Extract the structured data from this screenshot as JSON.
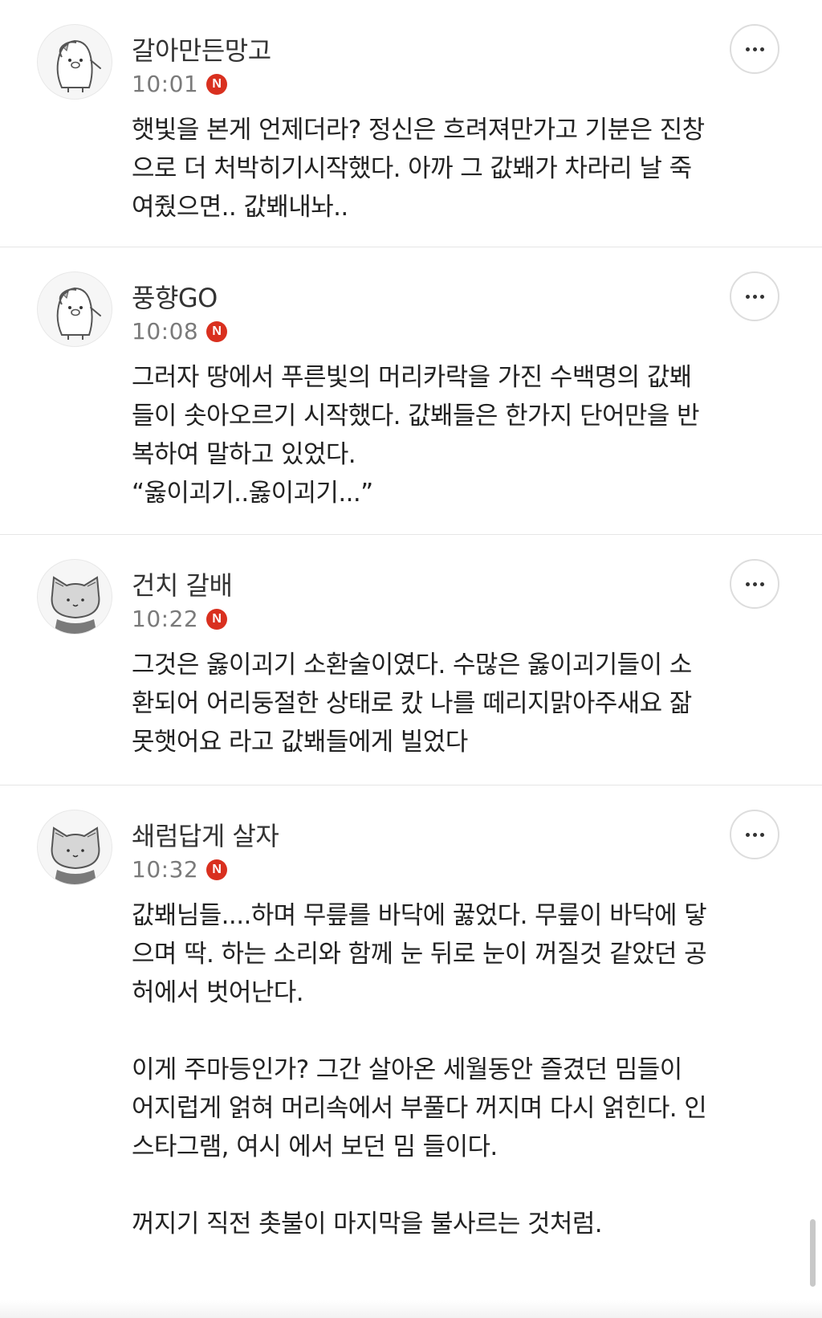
{
  "comments": [
    {
      "nickname": "갈아만든망고",
      "time": "10:01",
      "badge": "N",
      "avatar": "penguin-avatar-icon",
      "paragraphs": [
        "햇빛을 본게 언제더라? 정신은 흐려져만가고 기분은 진창\n으로 더 처박히기시작했다. 아까 그 값봬가 차라리 날 죽\n여줬으면.. 값봬내놔.."
      ]
    },
    {
      "nickname": "풍향GO",
      "time": "10:08",
      "badge": "N",
      "avatar": "penguin-avatar-icon",
      "paragraphs": [
        "그러자 땅에서 푸른빛의 머리카락을 가진 수백명의 값봬\n들이 솟아오르기 시작했다. 값봬들은 한가지 단어만을 반\n복하여 말하고 있었다.\n“옳이괴기..옳이괴기...”"
      ]
    },
    {
      "nickname": "건치 갈배",
      "time": "10:22",
      "badge": "N",
      "avatar": "cat-avatar-icon",
      "paragraphs": [
        "그것은 옳이괴기 소환술이였다. 수많은 옳이괴기들이 소\n환되어 어리둥절한 상태로 캈 나를 떼리지맑아주새요 잚\n못햇어요 라고 값봬들에게 빌었다"
      ]
    },
    {
      "nickname": "쇄럼답게 살자",
      "time": "10:32",
      "badge": "N",
      "avatar": "cat-avatar-icon",
      "paragraphs": [
        "값봬님들....하며 무릎를 바닥에 꿇었다. 무릎이 바닥에 닿\n으며 딱. 하는 소리와 함께 눈 뒤로 눈이 꺼질것 같았던 공\n허에서 벗어난다.",
        "이게 주마등인가? 그간 살아온 세월동안 즐겼던 밈들이\n어지럽게 얽혀 머리속에서 부풀다 꺼지며 다시 얽힌다. 인\n스타그램, 여시 에서 보던 밈 들이다.",
        "꺼지기 직전 촛불이 마지막을 불사르는 것처럼."
      ]
    }
  ],
  "colors": {
    "badge": "#d9301f",
    "time": "#7a7a7a",
    "text": "#222222",
    "divider": "#e6e6e6"
  }
}
